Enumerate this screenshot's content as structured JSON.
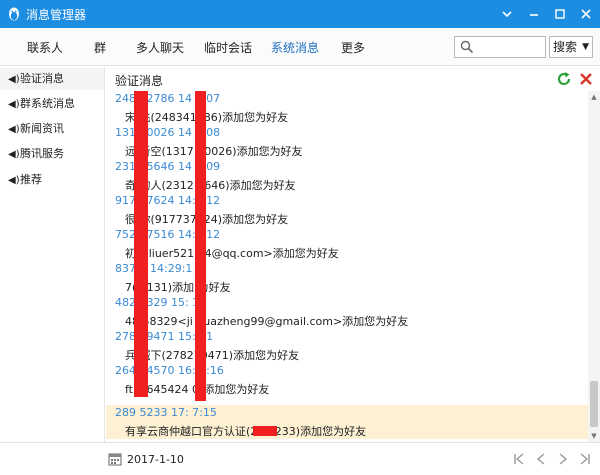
{
  "window": {
    "title": "消息管理器"
  },
  "nav": {
    "tabs": [
      "联系人",
      "群",
      "多人聊天",
      "临时会话",
      "系统消息",
      "更多"
    ],
    "active": "系统消息"
  },
  "search": {
    "placeholder": "",
    "select_label": "搜索"
  },
  "sidebar": {
    "items": [
      {
        "label": "验证消息"
      },
      {
        "label": "群系统消息"
      },
      {
        "label": "新闻资讯"
      },
      {
        "label": "腾讯服务"
      },
      {
        "label": "推荐"
      }
    ]
  },
  "content": {
    "header": "验证消息",
    "messages": [
      {
        "time": "2483  2786 14  9:07",
        "text": "宋  飞(248341786)添加您为好友"
      },
      {
        "time": "1317  0026 14  9:08",
        "text": "远  听空(1317  00026)添加您为好友"
      },
      {
        "time": "2312  5646 14  9:09",
        "text": "奇  的人(2312  5646)添加您为好友"
      },
      {
        "time": "9177  7624 14:2  12",
        "text": "很  你(917737624)添加您为好友"
      },
      {
        "time": "7527  7516 14:2  12",
        "text": "初  <liuer521  14@qq.com>添加您为好友"
      },
      {
        "time": "837  1 14:29:1  ",
        "text": "7(  7131)添加  为好友"
      },
      {
        "time": "482  8329 15:  14",
        "text": "48  58329<ji  huazheng99@gmail.com>添加您为好友"
      },
      {
        "time": "2782  9471 15:  21",
        "text": "兵  城下(278279471)添加您为好友"
      },
      {
        "time": "2645  4570 16:  2:16",
        "text": "fti  2645424  0)添加您为好友"
      },
      {
        "time": "289  5233 17:  7:15",
        "text": "有享云商仲越口官方认证(28      5233)添加您为好友"
      }
    ]
  },
  "footer": {
    "date": "2017-1-10"
  }
}
